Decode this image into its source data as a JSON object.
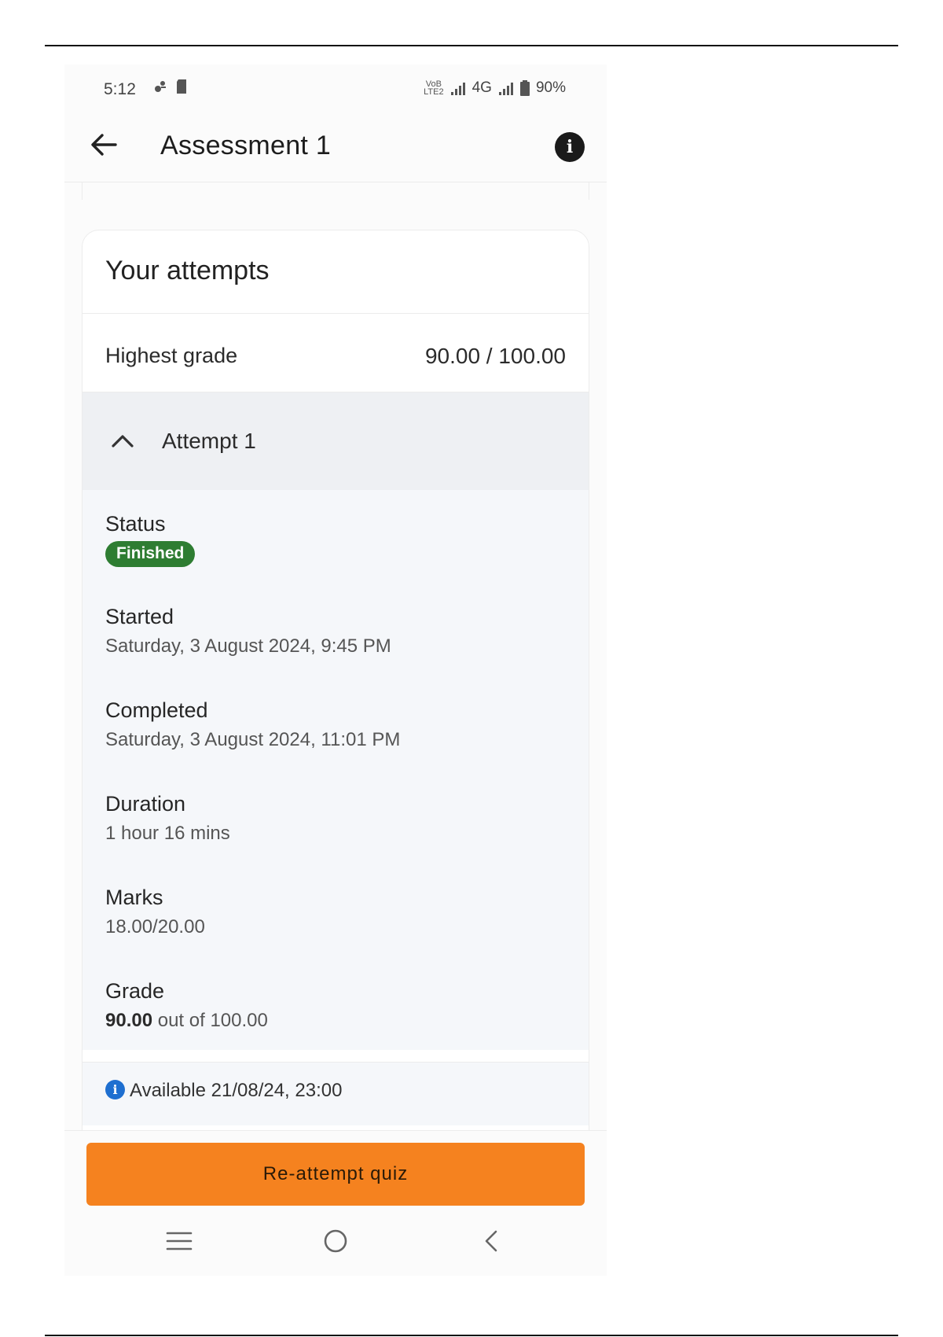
{
  "status_bar": {
    "time": "5:12",
    "network_small_top": "VoB",
    "network_small_bottom": "LTE2",
    "network_type": "4G",
    "battery": "90%"
  },
  "app_bar": {
    "title": "Assessment 1",
    "back_icon": "arrow-left-icon",
    "info_icon": "info-icon"
  },
  "card": {
    "title": "Your attempts",
    "highest_grade_label": "Highest grade",
    "highest_grade_value": "90.00 / 100.00",
    "attempt": {
      "title": "Attempt 1",
      "expanded": true,
      "status_label": "Status",
      "status_value": "Finished",
      "started_label": "Started",
      "started_value": "Saturday, 3 August 2024, 9:45 PM",
      "completed_label": "Completed",
      "completed_value": "Saturday, 3 August 2024, 11:01 PM",
      "duration_label": "Duration",
      "duration_value": "1 hour 16 mins",
      "marks_label": "Marks",
      "marks_value": "18.00/20.00",
      "grade_label": "Grade",
      "grade_score": "90.00",
      "grade_rest": " out of 100.00"
    },
    "availability": "Available 21/08/24, 23:00"
  },
  "actions": {
    "reattempt_label": "Re-attempt quiz"
  },
  "colors": {
    "accent": "#f5821f",
    "status_finished": "#2e7d32",
    "info_blue": "#1e6fd0"
  }
}
